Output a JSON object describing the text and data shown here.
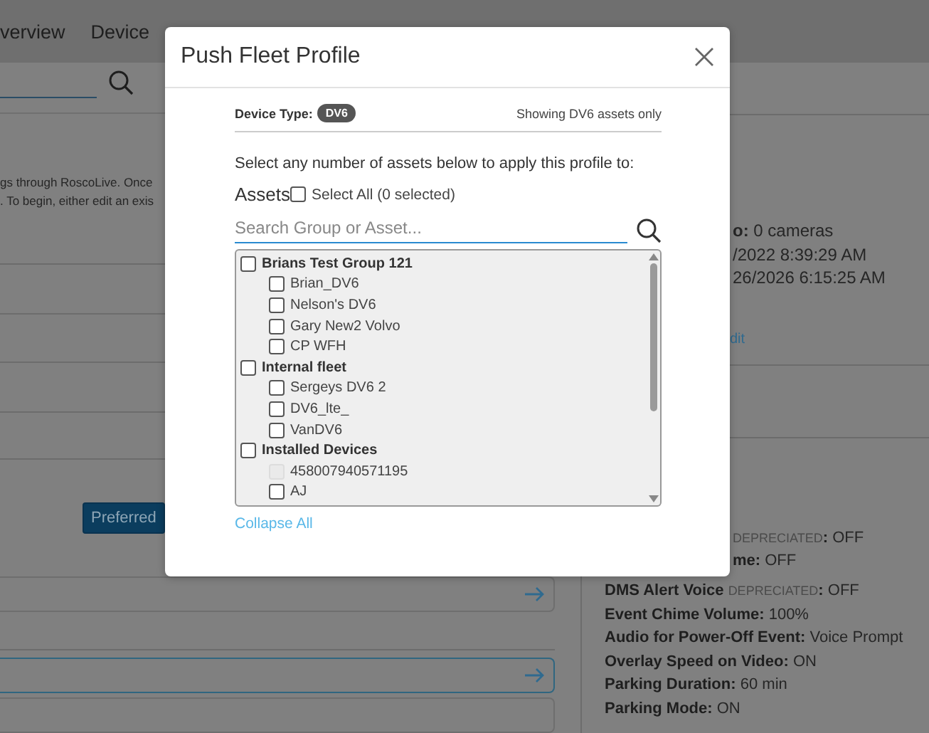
{
  "background": {
    "tabs": [
      "verview",
      "Device"
    ],
    "intro_lines": [
      "gs through RoscoLive. Once",
      ". To begin, either edit an exis"
    ],
    "preferred_button": "Preferred",
    "info_lines": [
      "**o:** 0 cameras",
      "/2022 8:39:29 AM",
      "26/2026 6:15:25 AM"
    ],
    "edit_link": "dit",
    "settings_cut": [
      {
        "tag": "DEPRECIATED",
        "colon": ":",
        "value": "OFF"
      },
      {
        "label": "me:",
        "value": "OFF"
      }
    ],
    "settings": [
      {
        "label": "DMS Alert Voice",
        "tag": "DEPRECIATED",
        "colon": ":",
        "value": "OFF"
      },
      {
        "label": "Event Chime Volume:",
        "value": "100%"
      },
      {
        "label": "Audio for Power-Off Event:",
        "value": "Voice Prompt"
      },
      {
        "label": "Overlay Speed on Video:",
        "value": "ON"
      },
      {
        "label": "Parking Duration:",
        "value": "60 min"
      },
      {
        "label": "Parking Mode:",
        "value": "ON"
      }
    ]
  },
  "dialog": {
    "title": "Push Fleet Profile",
    "device_type_label": "Device Type:",
    "device_type": "DV6",
    "filter_note": "Showing DV6 assets only",
    "instruction": "Select any number of assets below to apply this profile to:",
    "assets_label": "Assets",
    "select_all": {
      "label": "Select All (0 selected)",
      "checked": false
    },
    "search": {
      "placeholder": "Search Group or Asset..."
    },
    "tree": [
      {
        "label": "Brians Test Group 121",
        "checked": false,
        "disabled": false,
        "children": [
          {
            "label": "Brian_DV6",
            "checked": false,
            "disabled": false
          },
          {
            "label": "Nelson's DV6",
            "checked": false,
            "disabled": false
          },
          {
            "label": "Gary New2 Volvo",
            "checked": false,
            "disabled": false
          },
          {
            "label": "CP WFH",
            "checked": false,
            "disabled": false
          }
        ]
      },
      {
        "label": "Internal fleet",
        "checked": false,
        "disabled": false,
        "children": [
          {
            "label": "Sergeys DV6 2",
            "checked": false,
            "disabled": false
          },
          {
            "label": "DV6_lte_",
            "checked": false,
            "disabled": false
          },
          {
            "label": "VanDV6",
            "checked": false,
            "disabled": false
          }
        ]
      },
      {
        "label": "Installed Devices",
        "checked": false,
        "disabled": false,
        "children": [
          {
            "label": "458007940571195",
            "checked": false,
            "disabled": true
          },
          {
            "label": "AJ",
            "checked": false,
            "disabled": false
          }
        ]
      }
    ],
    "collapse_link": "Collapse All"
  }
}
